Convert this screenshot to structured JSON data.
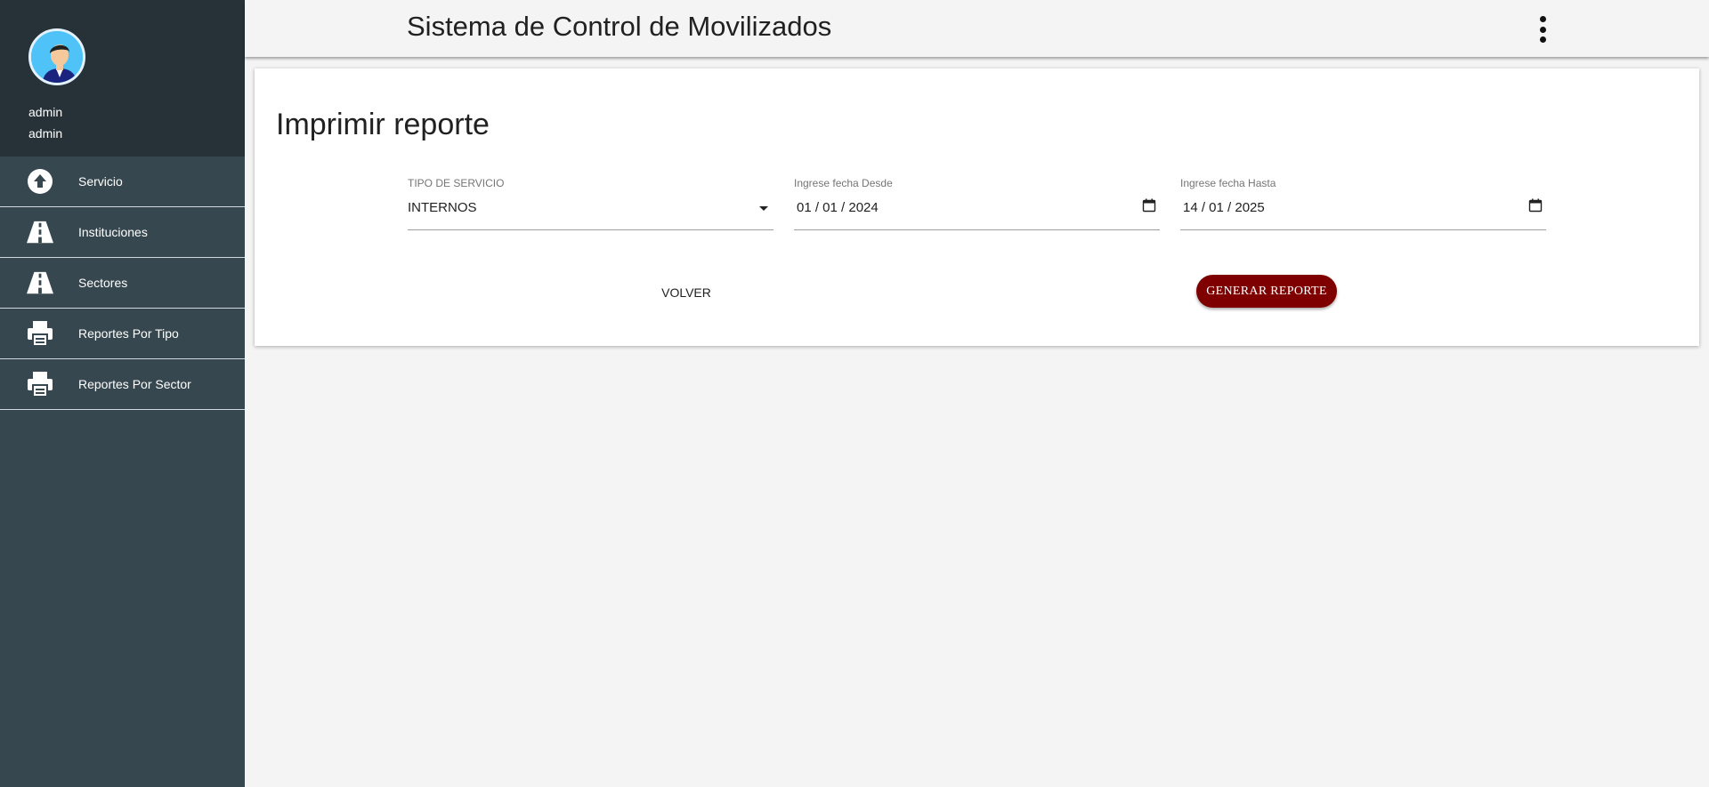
{
  "user": {
    "name": "admin",
    "role": "admin"
  },
  "sidebar": {
    "items": [
      {
        "label": "Servicio",
        "icon": "upload-circle-icon"
      },
      {
        "label": "Instituciones",
        "icon": "road-icon"
      },
      {
        "label": "Sectores",
        "icon": "road-icon"
      },
      {
        "label": "Reportes Por Tipo",
        "icon": "printer-icon"
      },
      {
        "label": "Reportes Por Sector",
        "icon": "printer-icon"
      }
    ]
  },
  "header": {
    "title": "Sistema de Control de Movilizados",
    "menu_icon": "more-vert-icon"
  },
  "main": {
    "title": "Imprimir reporte",
    "fields": {
      "tipo": {
        "label": "TIPO DE SERVICIO",
        "value": "INTERNOS"
      },
      "desde": {
        "label": "Ingrese fecha Desde",
        "value": "01 / 01 / 2024"
      },
      "hasta": {
        "label": "Ingrese fecha Hasta",
        "value": "14 / 01 / 2025"
      }
    },
    "buttons": {
      "volver": "VOLVER",
      "generar": "GENERAR REPORTE"
    }
  },
  "colors": {
    "sidebar": "#37474f",
    "sidebar_header": "#263238",
    "accent": "#7f0000"
  }
}
